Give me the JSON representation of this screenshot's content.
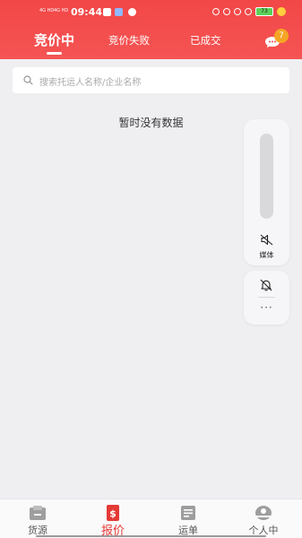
{
  "status_bar": {
    "signal1": "4G HD",
    "signal2": "4G HD",
    "time": "09:44",
    "battery": "73"
  },
  "header": {
    "tabs": [
      {
        "label": "竞价中",
        "active": true
      },
      {
        "label": "竞价失败",
        "active": false
      },
      {
        "label": "已成交",
        "active": false
      }
    ],
    "message_badge": "7"
  },
  "search": {
    "placeholder": "搜索托运人名称/企业名称"
  },
  "main": {
    "empty_text": "暂时没有数据"
  },
  "floating_panel": {
    "media_label": "媒体",
    "more": "···"
  },
  "bottom_nav": {
    "items": [
      {
        "label": "货源",
        "icon": "cargo-icon",
        "active": false
      },
      {
        "label": "报价",
        "icon": "quote-icon",
        "active": true
      },
      {
        "label": "运单",
        "icon": "waybill-icon",
        "active": false
      },
      {
        "label": "个人中",
        "icon": "profile-icon",
        "active": false
      }
    ]
  },
  "colors": {
    "brand": "#f24747",
    "active_nav": "#e53935",
    "badge": "#f5a524"
  }
}
